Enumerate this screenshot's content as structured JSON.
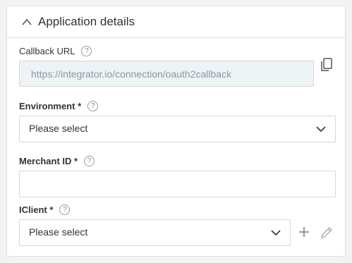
{
  "panel": {
    "title": "Application details"
  },
  "callback": {
    "label": "Callback URL",
    "value": "https://integrator.io/connection/oauth2callback"
  },
  "environment": {
    "label": "Environment *",
    "selected": "Please select"
  },
  "merchant": {
    "label": "Merchant ID *",
    "value": ""
  },
  "iclient": {
    "label": "IClient *",
    "selected": "Please select"
  },
  "help_glyph": "?",
  "icons": [
    "chevron-up-icon",
    "help-icon",
    "copy-icon",
    "chevron-down-icon",
    "plus-icon",
    "pencil-icon"
  ]
}
